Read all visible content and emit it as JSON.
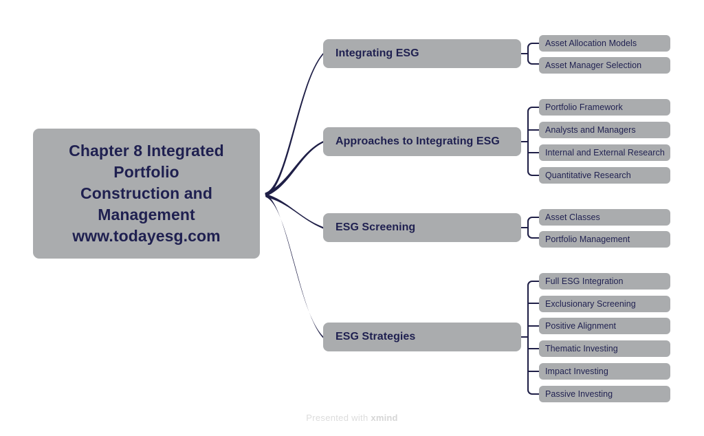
{
  "diagram": {
    "type": "mindmap",
    "colors": {
      "node_fill": "#aaacae",
      "node_text": "#1f2050",
      "connector": "#1f1f47",
      "background": "#ffffff",
      "watermark_text": "#dcdcdc"
    },
    "root": {
      "label": "Chapter 8 Integrated Portfolio Construction and Management www.todayesg.com",
      "lines": [
        "Chapter 8 Integrated",
        "Portfolio",
        "Construction and",
        "Management",
        "www.todayesg.com"
      ]
    },
    "branches": [
      {
        "label": "Integrating ESG",
        "children": [
          {
            "label": "Asset Allocation Models"
          },
          {
            "label": "Asset Manager Selection"
          }
        ]
      },
      {
        "label": "Approaches to Integrating ESG",
        "children": [
          {
            "label": "Portfolio Framework"
          },
          {
            "label": "Analysts and Managers"
          },
          {
            "label": "Internal and External Research"
          },
          {
            "label": "Quantitative Research"
          }
        ]
      },
      {
        "label": "ESG Screening",
        "children": [
          {
            "label": "Asset Classes"
          },
          {
            "label": "Portfolio Management"
          }
        ]
      },
      {
        "label": "ESG Strategies",
        "children": [
          {
            "label": "Full ESG Integration"
          },
          {
            "label": "Exclusionary Screening"
          },
          {
            "label": "Positive Alignment"
          },
          {
            "label": "Thematic Investing"
          },
          {
            "label": "Impact Investing"
          },
          {
            "label": "Passive Investing"
          }
        ]
      }
    ]
  },
  "footer": {
    "prefix": "Presented with",
    "brand": "xmind"
  }
}
